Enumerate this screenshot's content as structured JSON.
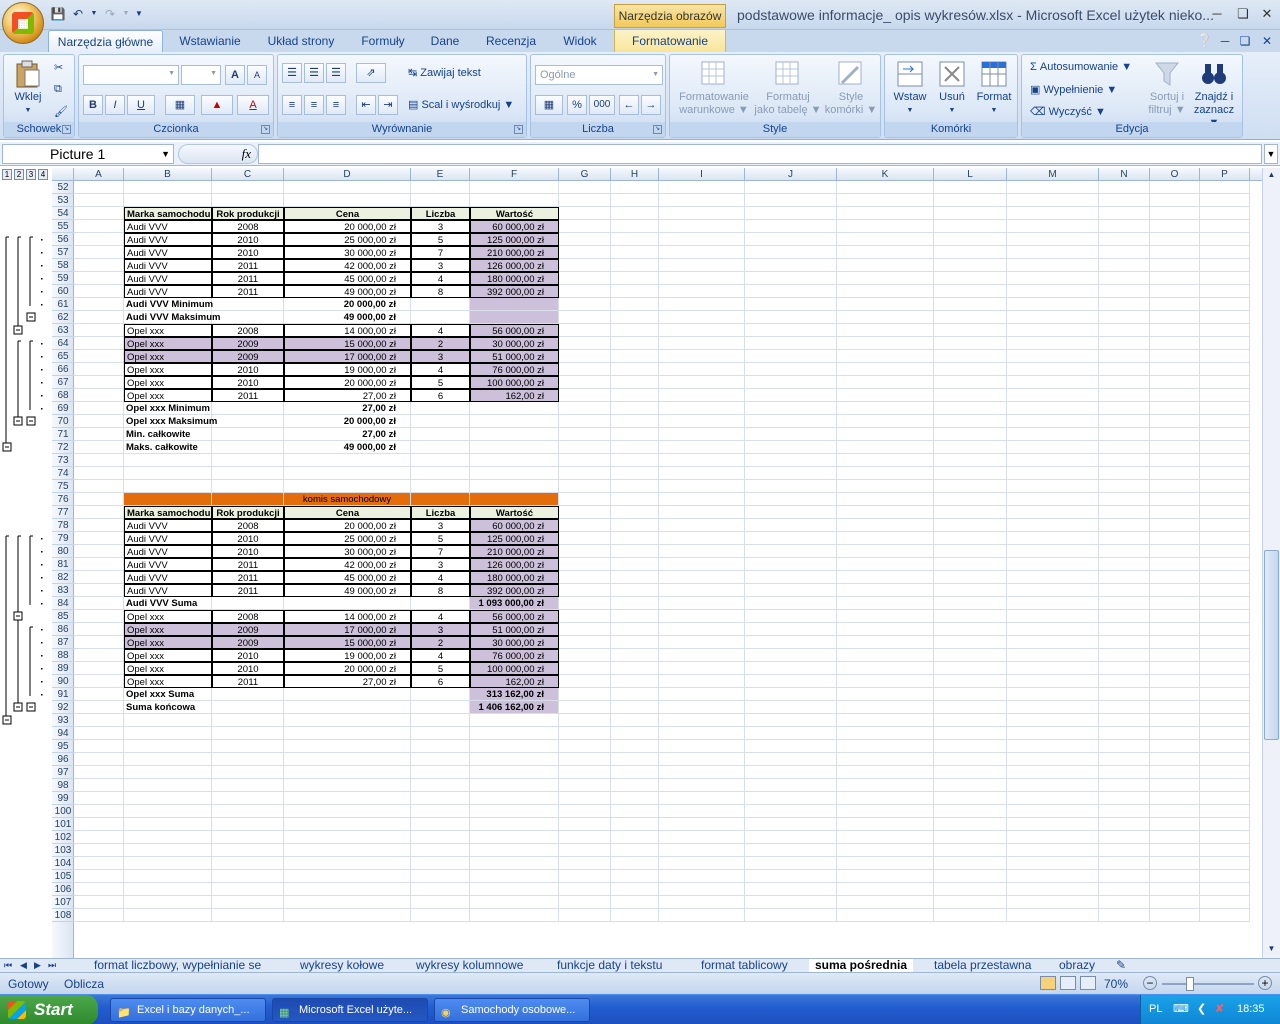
{
  "window": {
    "title": "podstawowe informacje_ opis wykresów.xlsx - Microsoft Excel użytek nieko...",
    "context_title": "Narzędzia obrazów"
  },
  "tabs": [
    "Narzędzia główne",
    "Wstawianie",
    "Układ strony",
    "Formuły",
    "Dane",
    "Recenzja",
    "Widok",
    "Formatowanie"
  ],
  "ribbon": {
    "clipboard": {
      "label": "Schowek",
      "paste": "Wklej"
    },
    "font": {
      "label": "Czcionka",
      "bold": "B",
      "italic": "I",
      "underline": "U",
      "grow": "A",
      "shrink": "A",
      "color": "A"
    },
    "alignment": {
      "label": "Wyrównanie",
      "wrap": "Zawijaj tekst",
      "merge": "Scal i wyśrodkuj"
    },
    "number": {
      "label": "Liczba",
      "format": "Ogólne",
      "percent": "%",
      "thousands": "000"
    },
    "styles": {
      "label": "Style",
      "cond_format_1": "Formatowanie",
      "cond_format_2": "warunkowe",
      "table_1": "Formatuj",
      "table_2": "jako tabelę",
      "cell_1": "Style",
      "cell_2": "komórki"
    },
    "cells": {
      "label": "Komórki",
      "insert": "Wstaw",
      "delete": "Usuń",
      "format": "Format"
    },
    "editing": {
      "label": "Edycja",
      "autosum": "Autosumowanie",
      "fill": "Wypełnienie",
      "clear": "Wyczyść",
      "sort_1": "Sortuj i",
      "sort_2": "filtruj",
      "find_1": "Znajdź i",
      "find_2": "zaznacz"
    }
  },
  "formula_bar": {
    "name_box": "Picture 1",
    "fx": "fx",
    "formula": ""
  },
  "outline_levels": [
    "1",
    "2",
    "3",
    "4"
  ],
  "columns": [
    "A",
    "B",
    "C",
    "D",
    "E",
    "F",
    "G",
    "H",
    "I",
    "J",
    "K",
    "L",
    "M",
    "N",
    "O",
    "P"
  ],
  "row_numbers": [
    "52",
    "53",
    "54",
    "55",
    "56",
    "57",
    "58",
    "59",
    "60",
    "61",
    "62",
    "63",
    "64",
    "65",
    "66",
    "67",
    "68",
    "69",
    "70",
    "71",
    "72",
    "73",
    "74",
    "75",
    "76",
    "77",
    "78",
    "79",
    "80",
    "81",
    "82",
    "83",
    "84",
    "85",
    "86",
    "87",
    "88",
    "89",
    "90",
    "91",
    "92",
    "93",
    "94",
    "95",
    "96",
    "97",
    "98",
    "99",
    "100",
    "101",
    "102",
    "103",
    "104",
    "105",
    "106",
    "107",
    "108"
  ],
  "table1": {
    "headers": [
      "Marka samochodu",
      "Rok produkcji",
      "Cena",
      "Liczba",
      "Wartość"
    ],
    "rows": [
      [
        "Audi VVV",
        "2008",
        "20 000,00 zł",
        "3",
        "60 000,00 zł"
      ],
      [
        "Audi VVV",
        "2010",
        "25 000,00 zł",
        "5",
        "125 000,00 zł"
      ],
      [
        "Audi VVV",
        "2010",
        "30 000,00 zł",
        "7",
        "210 000,00 zł"
      ],
      [
        "Audi VVV",
        "2011",
        "42 000,00 zł",
        "3",
        "126 000,00 zł"
      ],
      [
        "Audi VVV",
        "2011",
        "45 000,00 zł",
        "4",
        "180 000,00 zł"
      ],
      [
        "Audi VVV",
        "2011",
        "49 000,00 zł",
        "8",
        "392 000,00 zł"
      ],
      [
        "Audi VVV Minimum",
        "",
        "20 000,00 zł",
        "",
        ""
      ],
      [
        "Audi VVV Maksimum",
        "",
        "49 000,00 zł",
        "",
        ""
      ],
      [
        "Opel xxx",
        "2008",
        "14 000,00 zł",
        "4",
        "56 000,00 zł"
      ],
      [
        "Opel xxx",
        "2009",
        "15 000,00 zł",
        "2",
        "30 000,00 zł"
      ],
      [
        "Opel xxx",
        "2009",
        "17 000,00 zł",
        "3",
        "51 000,00 zł"
      ],
      [
        "Opel xxx",
        "2010",
        "19 000,00 zł",
        "4",
        "76 000,00 zł"
      ],
      [
        "Opel xxx",
        "2010",
        "20 000,00 zł",
        "5",
        "100 000,00 zł"
      ],
      [
        "Opel xxx",
        "2011",
        "27,00 zł",
        "6",
        "162,00 zł"
      ],
      [
        "Opel xxx Minimum",
        "",
        "27,00 zł",
        "",
        ""
      ],
      [
        "Opel xxx Maksimum",
        "",
        "20 000,00 zł",
        "",
        ""
      ],
      [
        "Min. całkowite",
        "",
        "27,00 zł",
        "",
        ""
      ],
      [
        "Maks. całkowite",
        "",
        "49 000,00 zł",
        "",
        ""
      ]
    ]
  },
  "table2": {
    "title": "komis samochodowy",
    "headers": [
      "Marka samochodu",
      "Rok produkcji",
      "Cena",
      "Liczba",
      "Wartość"
    ],
    "rows": [
      [
        "Audi VVV",
        "2008",
        "20 000,00 zł",
        "3",
        "60 000,00 zł"
      ],
      [
        "Audi VVV",
        "2010",
        "25 000,00 zł",
        "5",
        "125 000,00 zł"
      ],
      [
        "Audi VVV",
        "2010",
        "30 000,00 zł",
        "7",
        "210 000,00 zł"
      ],
      [
        "Audi VVV",
        "2011",
        "42 000,00 zł",
        "3",
        "126 000,00 zł"
      ],
      [
        "Audi VVV",
        "2011",
        "45 000,00 zł",
        "4",
        "180 000,00 zł"
      ],
      [
        "Audi VVV",
        "2011",
        "49 000,00 zł",
        "8",
        "392 000,00 zł"
      ],
      [
        "Audi VVV Suma",
        "",
        "",
        "",
        "1 093 000,00 zł"
      ],
      [
        "Opel xxx",
        "2008",
        "14 000,00 zł",
        "4",
        "56 000,00 zł"
      ],
      [
        "Opel xxx",
        "2009",
        "17 000,00 zł",
        "3",
        "51 000,00 zł"
      ],
      [
        "Opel xxx",
        "2009",
        "15 000,00 zł",
        "2",
        "30 000,00 zł"
      ],
      [
        "Opel xxx",
        "2010",
        "19 000,00 zł",
        "4",
        "76 000,00 zł"
      ],
      [
        "Opel xxx",
        "2010",
        "20 000,00 zł",
        "5",
        "100 000,00 zł"
      ],
      [
        "Opel xxx",
        "2011",
        "27,00 zł",
        "6",
        "162,00 zł"
      ],
      [
        "Opel xxx Suma",
        "",
        "",
        "",
        "313 162,00 zł"
      ],
      [
        "Suma końcowa",
        "",
        "",
        "",
        "1 406 162,00 zł"
      ]
    ]
  },
  "sheet_tabs": [
    "format liczbowy, wypełnianie se",
    "wykresy kołowe",
    "wykresy kolumnowe",
    "funkcje daty i tekstu",
    "format tablicowy",
    "suma pośrednia",
    "tabela przestawna",
    "obrazy"
  ],
  "active_sheet": "suma pośrednia",
  "status": {
    "ready": "Gotowy",
    "calc": "Oblicza",
    "zoom": "70%"
  },
  "taskbar": {
    "start": "Start",
    "tasks": [
      "Excel i bazy danych_...",
      "Microsoft Excel użyte...",
      "Samochody osobowe..."
    ],
    "lang": "PL",
    "time": "18:35"
  }
}
